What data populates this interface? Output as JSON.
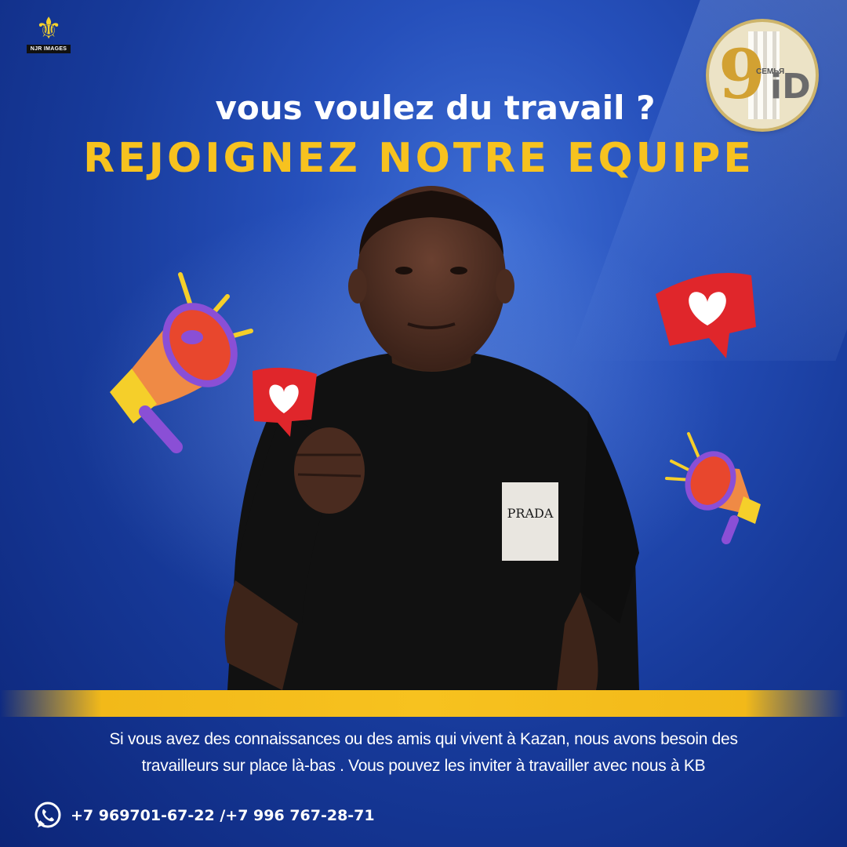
{
  "logo_left": {
    "text": "NJR IMAGES",
    "icon": "fleur-de-lis-icon"
  },
  "logo_right": {
    "text_cyrillic": "СЕМЬЯ",
    "text_id": "iD",
    "numeral": "9"
  },
  "subtitle": "vous voulez du travail ?",
  "headline": "REJOIGNEZ NOTRE EQUIPE",
  "body_text": "Si vous avez des connaissances ou des amis qui vivent à Kazan, nous avons besoin des travailleurs sur place là-bas . Vous pouvez les inviter à travailler avec nous à KB",
  "contact": {
    "icon": "whatsapp-icon",
    "phones": "+7 969701-67-22 /+7 996 767-28-71"
  },
  "shirt_label": "PRADA",
  "colors": {
    "background": "#1a3ea0",
    "accent_yellow": "#f7c21f",
    "text": "#ffffff",
    "heart_red": "#e0262b"
  }
}
